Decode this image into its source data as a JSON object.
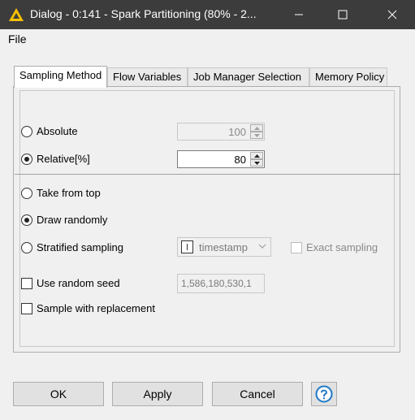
{
  "window": {
    "title": "Dialog - 0:141 - Spark Partitioning (80% - 2..."
  },
  "menu": {
    "file": "File"
  },
  "tabs": [
    {
      "label": "Sampling Method",
      "active": true
    },
    {
      "label": "Flow Variables",
      "active": false
    },
    {
      "label": "Job Manager Selection",
      "active": false
    },
    {
      "label": "Memory Policy",
      "active": false
    }
  ],
  "size": {
    "absolute": {
      "label": "Absolute",
      "selected": false,
      "value": "100",
      "enabled": false
    },
    "relative": {
      "label": "Relative[%]",
      "selected": true,
      "value": "80",
      "enabled": true
    }
  },
  "method": {
    "take_from_top": {
      "label": "Take from top",
      "selected": false
    },
    "draw_randomly": {
      "label": "Draw randomly",
      "selected": true
    },
    "stratified": {
      "label": "Stratified sampling",
      "selected": false
    },
    "stratified_column": "timestamp",
    "exact_sampling": {
      "label": "Exact sampling",
      "checked": false,
      "enabled": false
    }
  },
  "seed": {
    "label": "Use random seed",
    "checked": false,
    "value": "1,586,180,530,1"
  },
  "replacement": {
    "label": "Sample with replacement",
    "checked": false
  },
  "buttons": {
    "ok": "OK",
    "apply": "Apply",
    "cancel": "Cancel"
  },
  "colors": {
    "titlebar": "#3c3c3c",
    "help_icon": "#1e78c8",
    "app_icon": "#f5c000"
  }
}
